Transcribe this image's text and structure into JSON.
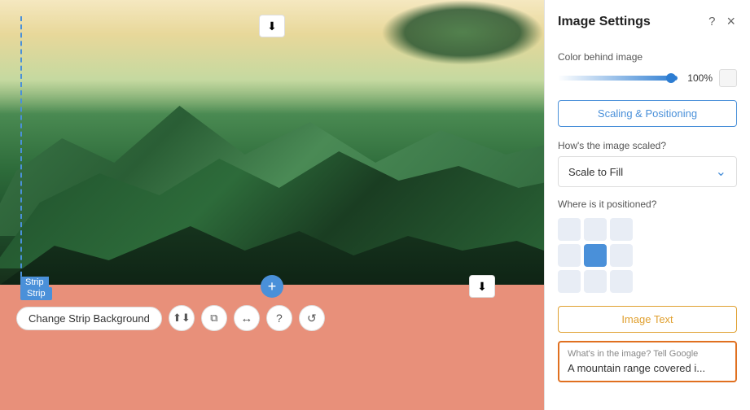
{
  "canvas": {
    "strip_label_top": "Strip",
    "strip_label": "Strip",
    "download_icon_top": "⬇",
    "download_icon_mid": "⬇",
    "plus_icon": "+",
    "toolbar": {
      "change_bg_label": "Change Strip Background",
      "icon1": "⬆⬇",
      "icon2": "⧉",
      "icon3": "↔",
      "icon4": "?",
      "icon5": "↺"
    }
  },
  "panel": {
    "title": "Image Settings",
    "help_icon": "?",
    "close_icon": "×",
    "color_section": {
      "label": "Color behind image",
      "opacity": "100%"
    },
    "scaling_btn_label": "Scaling & Positioning",
    "scaling_section": {
      "how_label": "How's the image scaled?",
      "scale_value": "Scale to Fill",
      "chevron": "⌄",
      "where_label": "Where is it positioned?"
    },
    "image_text_tab": "Image Text",
    "alt_text": {
      "hint": "What's in the image? Tell Google",
      "value": "A mountain range covered i..."
    }
  }
}
